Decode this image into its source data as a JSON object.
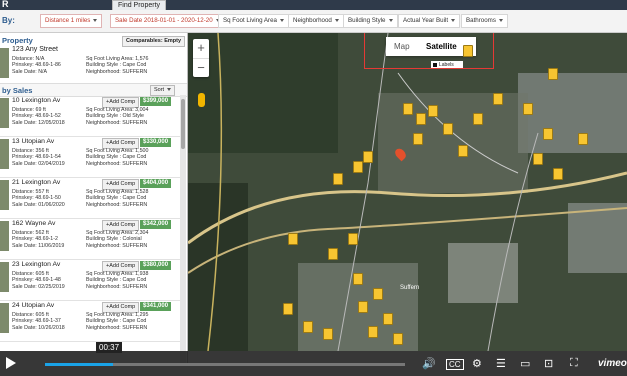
{
  "app": {
    "logo": "R",
    "find_button": "Find Property"
  },
  "filters": {
    "by_label": "By:",
    "chips": [
      {
        "label": "Distance 1 miles",
        "style": "red"
      },
      {
        "label": "Sale Date 2018-01-01 - 2020-12-20",
        "style": "red"
      },
      {
        "label": "Sq Foot Living Area",
        "style": "normal"
      },
      {
        "label": "Neighborhood",
        "style": "normal"
      },
      {
        "label": "Building Style",
        "style": "normal"
      },
      {
        "label": "Actual Year Built",
        "style": "normal"
      },
      {
        "label": "Bathrooms",
        "style": "normal"
      }
    ]
  },
  "subject": {
    "header": "Property",
    "comparables_button": "Comparables: Empty",
    "address": "123 Any Street",
    "line1_left": "Distance: N/A",
    "line2_left": "Prinskey: 48.69-1-86",
    "line3_left": "Sale Date: N/A",
    "line1_right": "Sq Foot Living Area: 1,576",
    "line2_right": "Building Style : Cape Cod",
    "line3_right": "Neighborhood: SUFFERN"
  },
  "sales": {
    "header": "by Sales",
    "sort_button": "Sort",
    "add_label": "Add Comp",
    "rows": [
      {
        "address": "10 Lexington Av",
        "price": "$399,000",
        "distance": "Distance: 69 ft",
        "prinskey": "Prinskey: 48.69-1-52",
        "sale_date": "Sale Date: 12/05/2018",
        "sqft": "Sq Foot Living Area: 3,004",
        "style": "Building Style : Old Style",
        "hood": "Neighborhood: SUFFERN"
      },
      {
        "address": "13 Utopian Av",
        "price": "$330,000",
        "distance": "Distance: 356 ft",
        "prinskey": "Prinskey: 48.69-1-54",
        "sale_date": "Sale Date: 02/04/2019",
        "sqft": "Sq Foot Living Area: 1,500",
        "style": "Building Style : Cape Cod",
        "hood": "Neighborhood: SUFFERN"
      },
      {
        "address": "21 Lexington Av",
        "price": "$404,000",
        "distance": "Distance: 557 ft",
        "prinskey": "Prinskey: 48.69-1-50",
        "sale_date": "Sale Date: 01/06/2020",
        "sqft": "Sq Foot Living Area: 1,528",
        "style": "Building Style : Cape Cod",
        "hood": "Neighborhood: SUFFERN"
      },
      {
        "address": "162 Wayne Av",
        "price": "$342,000",
        "distance": "Distance: 562 ft",
        "prinskey": "Prinskey: 48.69-1-2",
        "sale_date": "Sale Date: 11/06/2019",
        "sqft": "Sq Foot Living Area: 2,304",
        "style": "Building Style : Colonial",
        "hood": "Neighborhood: SUFFERN"
      },
      {
        "address": "23 Lexington Av",
        "price": "$380,000",
        "distance": "Distance: 605 ft",
        "prinskey": "Prinskey: 48.69-1-48",
        "sale_date": "Sale Date: 02/25/2019",
        "sqft": "Sq Foot Living Area: 1,938",
        "style": "Building Style : Cape Cod",
        "hood": "Neighborhood: SUFFERN"
      },
      {
        "address": "24 Utopian Av",
        "price": "$341,000",
        "distance": "Distance: 605 ft",
        "prinskey": "Prinskey: 48.69-1-37",
        "sale_date": "Sale Date: 10/26/2018",
        "sqft": "Sq Foot Living Area: 1,295",
        "style": "Building Style : Cape Cod",
        "hood": "Neighborhood: SUFFERN"
      }
    ]
  },
  "map": {
    "zoom_in": "+",
    "zoom_out": "−",
    "type_map": "Map",
    "type_satellite": "Satellite",
    "labels_option": "Labels",
    "town_label": "Suffern"
  },
  "video": {
    "timecode": "00:37",
    "progress": 0.19,
    "brand": "vimeo"
  }
}
